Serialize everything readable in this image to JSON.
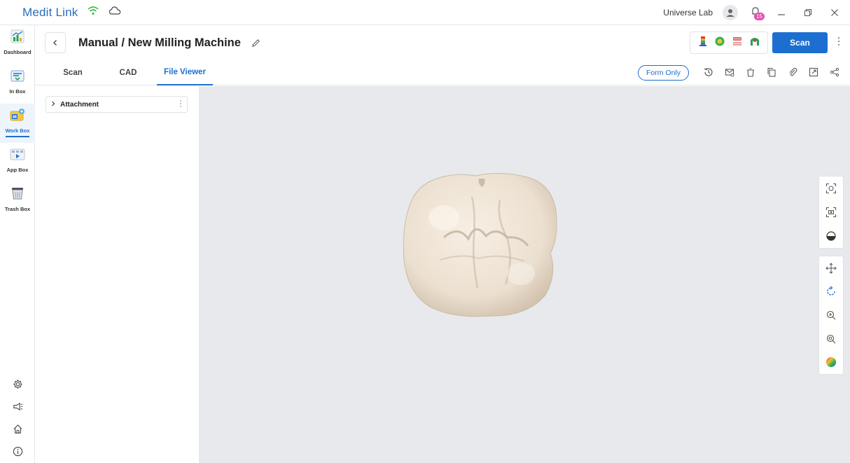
{
  "app": {
    "brand": "Medit Link",
    "lab_name": "Universe Lab",
    "notification_count": "15"
  },
  "nav": {
    "items": [
      {
        "label": "Dashboard",
        "icon": "dashboard-icon"
      },
      {
        "label": "In Box",
        "icon": "inbox-icon"
      },
      {
        "label": "Work Box",
        "icon": "workbox-icon",
        "active": true
      },
      {
        "label": "App Box",
        "icon": "appbox-icon"
      },
      {
        "label": "Trash Box",
        "icon": "trash-box-icon"
      }
    ],
    "bottom_icons": [
      "settings-icon",
      "announcement-icon",
      "home-icon",
      "info-icon"
    ]
  },
  "header": {
    "title": "Manual / New Milling Machine",
    "scan_label": "Scan",
    "tool_icons": [
      "color-bar-icon",
      "tooth-color-icon",
      "jaw-icon",
      "arch-icon"
    ]
  },
  "tabs": {
    "items": [
      "Scan",
      "CAD",
      "File Viewer"
    ],
    "active": "File Viewer",
    "form_only_label": "Form Only",
    "actions": [
      "history-icon",
      "mail-icon",
      "delete-icon",
      "copy-icon",
      "attach-icon",
      "export-icon",
      "share-icon"
    ]
  },
  "panel": {
    "attachment_label": "Attachment"
  },
  "viewer": {
    "tools_top": [
      "fit-view-icon",
      "screenshot-icon",
      "half-view-icon"
    ],
    "tools_bottom": [
      "pan-icon",
      "rotate-icon",
      "zoom-in-icon",
      "zoom-out-icon",
      "color-map-icon"
    ]
  },
  "colors": {
    "accent": "#1c6fd0",
    "viewer_bg": "#e8e9ec",
    "tooth": "#efe4d6"
  }
}
